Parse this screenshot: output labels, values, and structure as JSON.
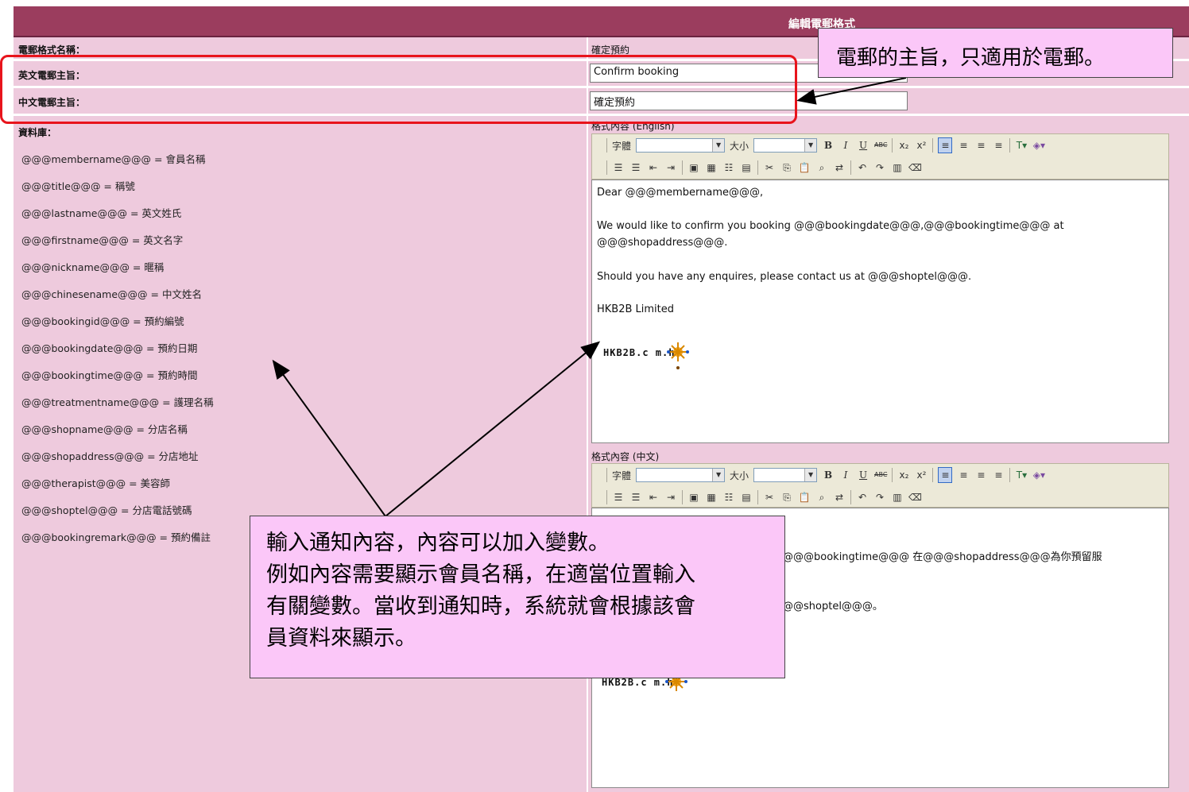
{
  "header": {
    "title": "編輯電郵格式"
  },
  "form": {
    "name_label": "電郵格式名稱：",
    "name_value": "確定預約",
    "en_subject_label": "英文電郵主旨：",
    "en_subject_value": "Confirm booking",
    "zh_subject_label": "中文電郵主旨：",
    "zh_subject_value": "確定預約",
    "database_label": "資料庫：",
    "content_en_label": "格式內容 (English)",
    "content_zh_label": "格式內容 (中文)"
  },
  "variables": [
    "@@@membername@@@ = 會員名稱",
    "@@@title@@@ = 稱號",
    "@@@lastname@@@ = 英文姓氏",
    "@@@firstname@@@ = 英文名字",
    "@@@nickname@@@ = 暱稱",
    "@@@chinesename@@@ = 中文姓名",
    "@@@bookingid@@@ = 預約編號",
    "@@@bookingdate@@@ = 預約日期",
    "@@@bookingtime@@@ = 預約時間",
    "@@@treatmentname@@@ = 護理名稱",
    "@@@shopname@@@ = 分店名稱",
    "@@@shopaddress@@@ = 分店地址",
    "@@@therapist@@@ = 美容師",
    "@@@shoptel@@@ = 分店電話號碼",
    "@@@bookingremark@@@ = 預約備註"
  ],
  "toolbar": {
    "font_label": "字體",
    "size_label": "大小",
    "bold": "B",
    "italic": "I",
    "underline": "U",
    "strike": "ABC",
    "subscript": "x₂",
    "superscript": "x²"
  },
  "editor_en": {
    "line1": "Dear @@@membername@@@,",
    "line2": "We would like to confirm you booking @@@bookingdate@@@,@@@bookingtime@@@ at",
    "line3": "@@@shopaddress@@@.",
    "line4": "Should you have any enquires, please contact us at @@@shoptel@@@.",
    "line5": "HKB2B Limited",
    "logo": "HKB2B.c m.hk"
  },
  "editor_zh": {
    "line1": "@@@bookingtime@@@ 在@@@shopaddress@@@為你預留服",
    "line2": "@@shoptel@@@。",
    "logo": "HKB2B.c m.hk"
  },
  "callouts": {
    "subject_note": "電郵的主旨，只適用於電郵。",
    "content_note_1": "輸入通知內容，內容可以加入變數。",
    "content_note_2": "例如內容需要顯示會員名稱，在適當位置輸入",
    "content_note_3": "有關變數。當收到通知時，系統就會根據該會",
    "content_note_4": "員資料來顯示。"
  },
  "colors": {
    "header_bg": "#9b3d5e",
    "panel_bg": "#eecadd",
    "callout_bg": "#fbc7f8",
    "highlight_border": "#e8141c"
  }
}
